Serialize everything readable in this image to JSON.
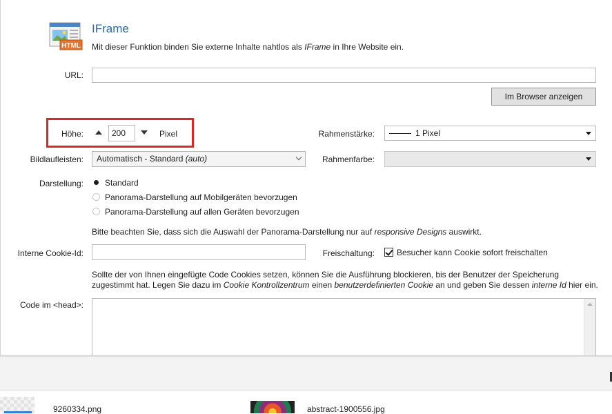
{
  "header": {
    "icon": "html-iframe-icon",
    "title": "IFrame",
    "desc_pre": "Mit dieser Funktion binden Sie externe Inhalte nahtlos als ",
    "desc_em": "IFrame",
    "desc_post": " in Ihre Website ein."
  },
  "url": {
    "label": "URL:",
    "value": "",
    "browser_button": "Im Browser anzeigen"
  },
  "height": {
    "label": "Höhe:",
    "value": "200",
    "unit": "Pixel"
  },
  "frame_width": {
    "label": "Rahmenstärke:",
    "value": "1 Pixel"
  },
  "scrollbars": {
    "label": "Bildlaufleisten:",
    "value": "Automatisch - Standard ",
    "value_em": "(auto)"
  },
  "frame_color": {
    "label": "Rahmenfarbe:",
    "value": ""
  },
  "display": {
    "label": "Darstellung:",
    "options": [
      {
        "label": "Standard",
        "checked": true
      },
      {
        "label": "Panorama-Darstellung auf Mobilgeräten bevorzugen",
        "checked": false
      },
      {
        "label": "Panorama-Darstellung auf allen Geräten bevorzugen",
        "checked": false
      }
    ],
    "note_pre": "Bitte beachten Sie, dass sich die Auswahl der Panorama-Darstellung nur auf ",
    "note_em": "responsive Designs",
    "note_post": " auswirkt."
  },
  "cookie": {
    "label": "Interne Cookie-Id:",
    "value": "",
    "release_label": "Freischaltung:",
    "release_checkbox": "Besucher kann Cookie sofort freischalten",
    "release_checked": true,
    "info_line1": "Sollte der von Ihnen eingefügte Code Cookies setzen, können Sie die Ausführung blockieren, bis der Benutzer der Speicherung",
    "info_l2_a": "zugestimmt hat. Legen Sie dazu im ",
    "info_l2_b": "Cookie Kontrollzentrum",
    "info_l2_c": " einen ",
    "info_l2_d": "benutzerdefinierten Cookie",
    "info_l2_e": " an und geben Sie dessen ",
    "info_l2_f": "interne Id",
    "info_l2_g": " hier ein."
  },
  "head_code": {
    "label": "Code im <head>:",
    "value": ""
  },
  "files": [
    {
      "name": "9260334.png"
    },
    {
      "name": "abstract-1900556.jpg"
    }
  ],
  "colors": {
    "accent_title": "#2b6aa8",
    "highlight_box": "#d42a2a"
  }
}
